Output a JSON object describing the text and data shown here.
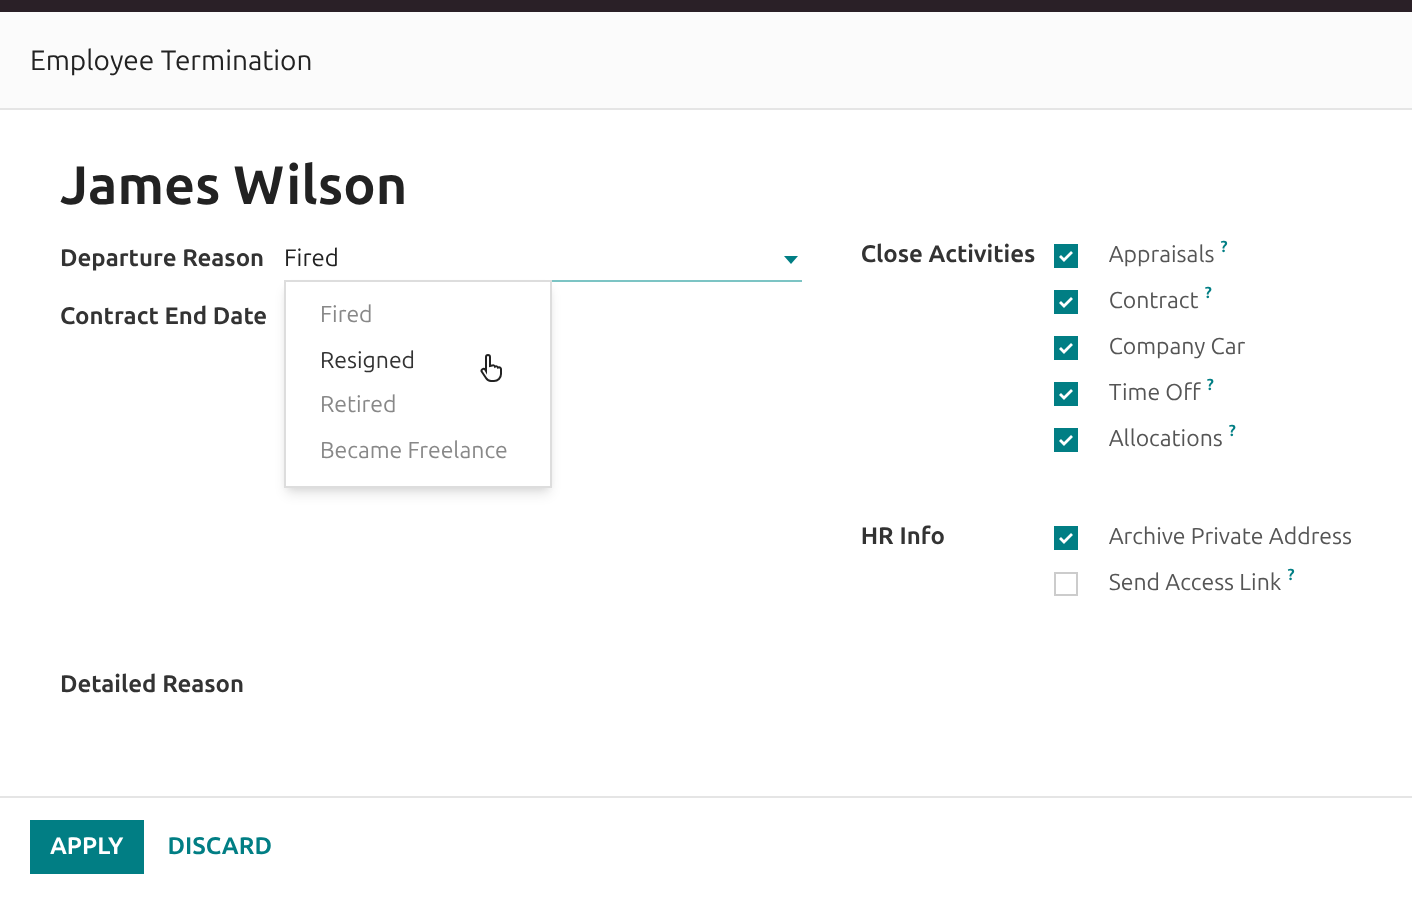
{
  "dialog": {
    "title": "Employee Termination"
  },
  "employee_name": "James Wilson",
  "fields": [
    {
      "label": "Departure Reason",
      "value": "Fired"
    },
    {
      "label": "Contract End Date"
    },
    {
      "label": "Detailed Reason"
    }
  ],
  "dropdown": {
    "options": [
      {
        "label": "Fired",
        "hovered": false
      },
      {
        "label": "Resigned",
        "hovered": true
      },
      {
        "label": "Retired",
        "hovered": false
      },
      {
        "label": "Became Freelance",
        "hovered": false
      }
    ]
  },
  "close_activities": {
    "label": "Close Activities",
    "items": [
      {
        "label": "Appraisals",
        "checked": true,
        "help": "?"
      },
      {
        "label": "Contract",
        "checked": true,
        "help": "?"
      },
      {
        "label": "Company Car",
        "checked": true
      },
      {
        "label": "Time Off",
        "checked": true,
        "help": "?"
      },
      {
        "label": "Allocations",
        "checked": true,
        "help": "?"
      }
    ]
  },
  "hr_info": {
    "label": "HR Info",
    "items": [
      {
        "label": "Archive Private Address",
        "checked": true
      },
      {
        "label": "Send Access Link",
        "checked": false,
        "help": "?"
      }
    ]
  },
  "buttons": [
    {
      "label": "APPLY",
      "kind": "primary"
    },
    {
      "label": "DISCARD",
      "kind": "link"
    }
  ]
}
